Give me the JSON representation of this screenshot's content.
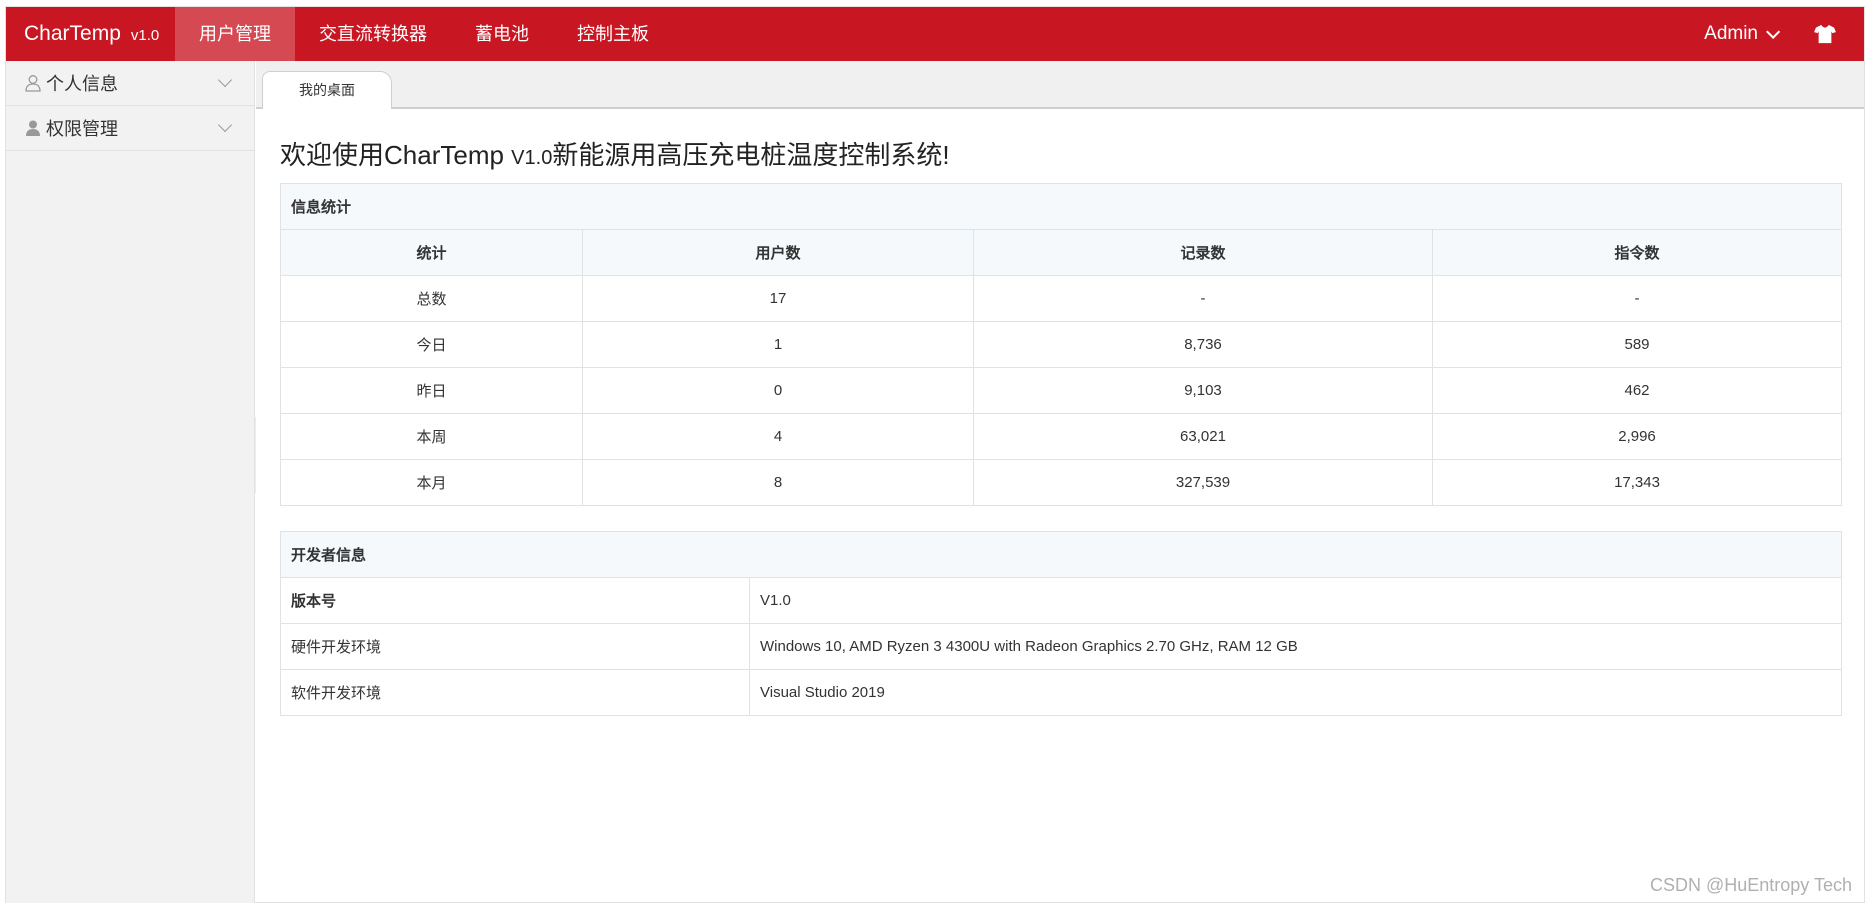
{
  "header": {
    "brand_name": "CharTemp",
    "brand_version": "v1.0",
    "nav": [
      "用户管理",
      "交直流转换器",
      "蓄电池",
      "控制主板"
    ],
    "active_nav_index": 0,
    "user": "Admin",
    "colors": {
      "brand": "#c91623"
    }
  },
  "sidebar": {
    "items": [
      {
        "label": "个人信息",
        "icon": "user-outline-icon"
      },
      {
        "label": "权限管理",
        "icon": "user-filled-icon"
      }
    ]
  },
  "tabs": [
    "我的桌面"
  ],
  "welcome": {
    "prefix": "欢迎使用CharTemp ",
    "version": "V1.0",
    "suffix": "新能源用高压充电桩温度控制系统!"
  },
  "stats": {
    "caption": "信息统计",
    "headers": [
      "统计",
      "用户数",
      "记录数",
      "指令数"
    ],
    "rows": [
      [
        "总数",
        "17",
        "-",
        "-"
      ],
      [
        "今日",
        "1",
        "8,736",
        "589"
      ],
      [
        "昨日",
        "0",
        "9,103",
        "462"
      ],
      [
        "本周",
        "4",
        "63,021",
        "2,996"
      ],
      [
        "本月",
        "8",
        "327,539",
        "17,343"
      ]
    ]
  },
  "developer": {
    "caption": "开发者信息",
    "rows": [
      [
        "版本号",
        "V1.0"
      ],
      [
        "硬件开发环境",
        "Windows 10, AMD Ryzen 3 4300U with Radeon Graphics 2.70 GHz, RAM 12 GB"
      ],
      [
        "软件开发环境",
        "Visual Studio 2019"
      ]
    ]
  },
  "watermark": "CSDN @HuEntropy Tech"
}
